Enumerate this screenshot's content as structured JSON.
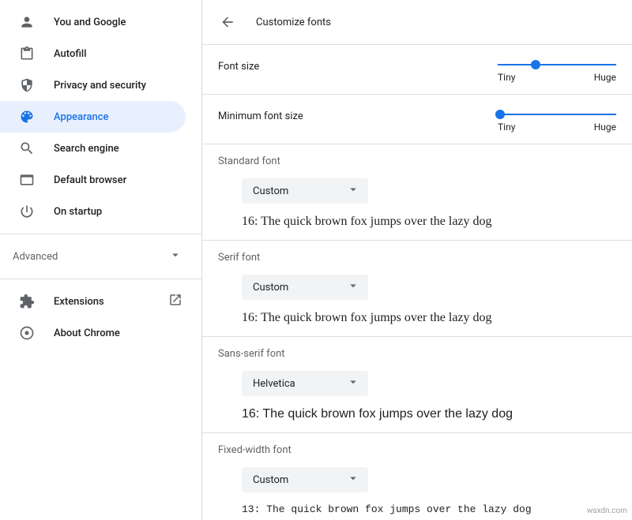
{
  "sidebar": {
    "items": [
      {
        "label": "You and Google"
      },
      {
        "label": "Autofill"
      },
      {
        "label": "Privacy and security"
      },
      {
        "label": "Appearance"
      },
      {
        "label": "Search engine"
      },
      {
        "label": "Default browser"
      },
      {
        "label": "On startup"
      }
    ],
    "advanced": "Advanced",
    "extensions": "Extensions",
    "about": "About Chrome"
  },
  "header": {
    "title": "Customize fonts"
  },
  "sliders": {
    "font_size": {
      "label": "Font size",
      "min_label": "Tiny",
      "max_label": "Huge",
      "position_pct": 32
    },
    "min_font_size": {
      "label": "Minimum font size",
      "min_label": "Tiny",
      "max_label": "Huge",
      "position_pct": 2
    }
  },
  "fonts": {
    "standard": {
      "label": "Standard font",
      "selected": "Custom",
      "preview": "16: The quick brown fox jumps over the lazy dog"
    },
    "serif": {
      "label": "Serif font",
      "selected": "Custom",
      "preview": "16: The quick brown fox jumps over the lazy dog"
    },
    "sans": {
      "label": "Sans-serif font",
      "selected": "Helvetica",
      "preview": "16: The quick brown fox jumps over the lazy dog"
    },
    "mono": {
      "label": "Fixed-width font",
      "selected": "Custom",
      "preview": "13: The quick brown fox jumps over the lazy dog"
    }
  },
  "watermark": "wsxdn.com"
}
